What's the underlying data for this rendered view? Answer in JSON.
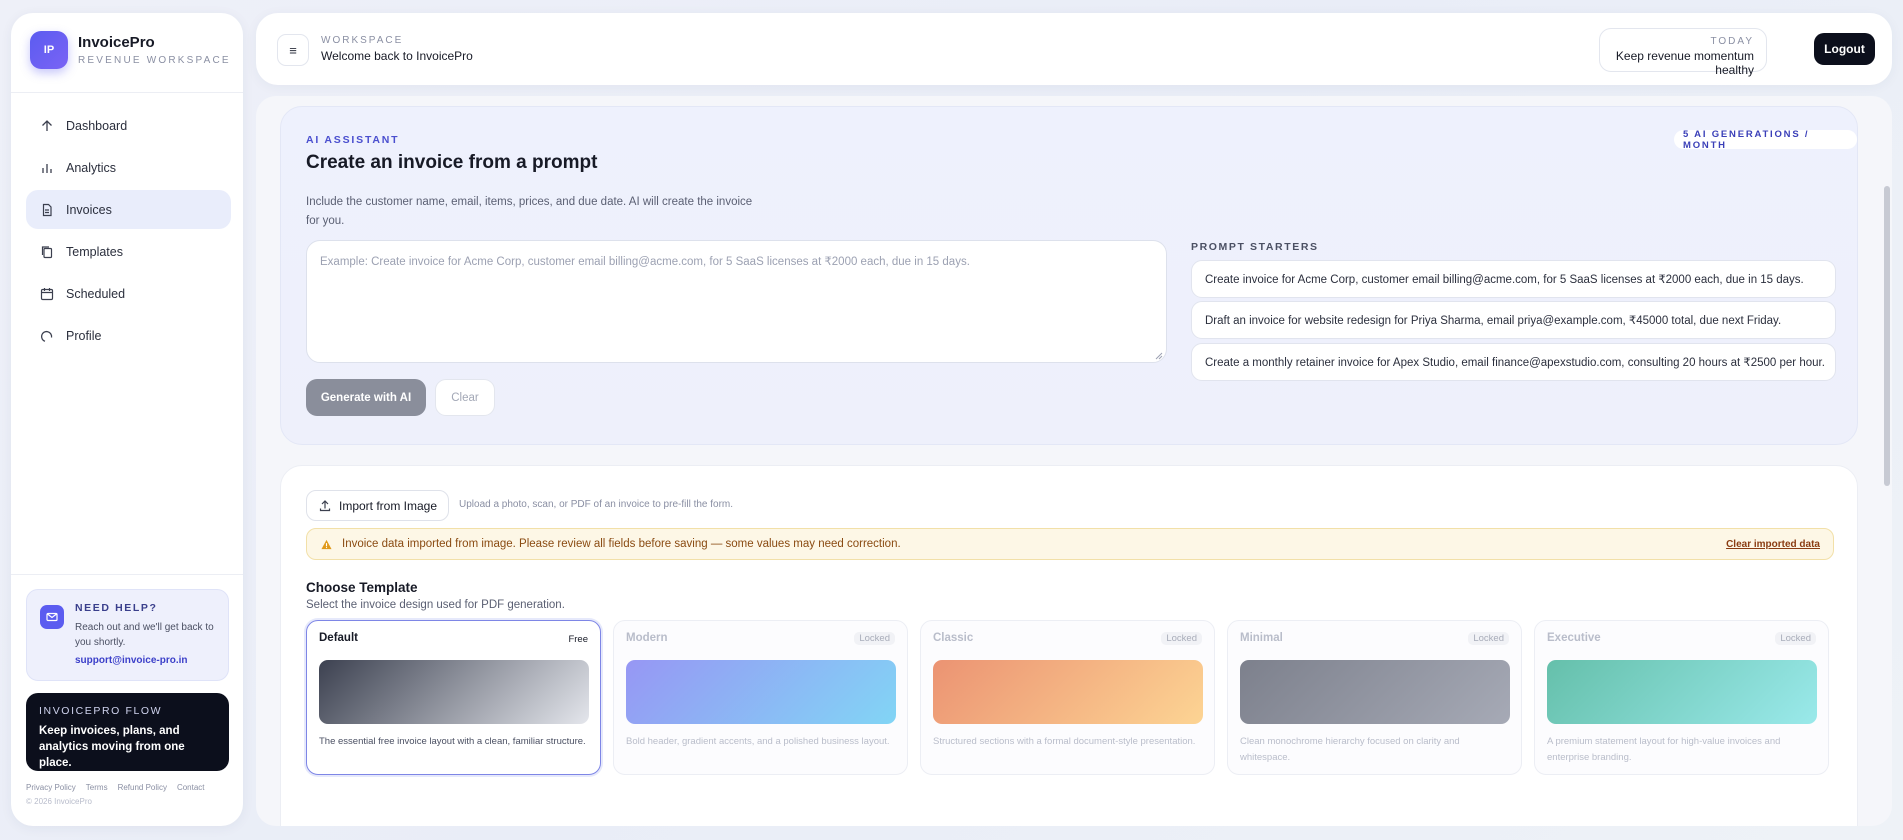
{
  "brand": {
    "logo_text": "IP",
    "name": "InvoicePro",
    "subtitle": "REVENUE WORKSPACE"
  },
  "sidebar": {
    "items": [
      {
        "label": "Dashboard",
        "icon": "arrow-up-icon"
      },
      {
        "label": "Analytics",
        "icon": "bar-chart-icon"
      },
      {
        "label": "Invoices",
        "icon": "document-icon",
        "active": true
      },
      {
        "label": "Templates",
        "icon": "copy-icon"
      },
      {
        "label": "Scheduled",
        "icon": "calendar-icon"
      },
      {
        "label": "Profile",
        "icon": "profile-icon"
      }
    ],
    "help": {
      "title": "NEED HELP?",
      "text": "Reach out and we'll get back to you shortly.",
      "email": "support@invoice-pro.in"
    },
    "flow": {
      "title": "INVOICEPRO FLOW",
      "text": "Keep invoices, plans, and analytics moving from one place."
    },
    "footer_links": [
      "Privacy Policy",
      "Terms",
      "Refund Policy",
      "Contact"
    ],
    "copyright": "© 2026 InvoicePro"
  },
  "header": {
    "menu_icon": "≡",
    "workspace_label": "WORKSPACE",
    "welcome": "Welcome back to InvoicePro",
    "today_label": "TODAY",
    "today_text": "Keep revenue momentum healthy",
    "logout": "Logout"
  },
  "ai": {
    "kicker": "AI ASSISTANT",
    "title": "Create an invoice from a prompt",
    "description": "Include the customer name, email, items, prices, and due date. AI will create the invoice for you.",
    "badge": "5 AI GENERATIONS / MONTH",
    "prompt_placeholder": "Example: Create invoice for Acme Corp, customer email billing@acme.com, for 5 SaaS licenses at ₹2000 each, due in 15 days.",
    "generate_label": "Generate with AI",
    "clear_label": "Clear",
    "starters_label": "PROMPT STARTERS",
    "starters": [
      "Create invoice for Acme Corp, customer email billing@acme.com, for 5 SaaS licenses at ₹2000 each, due in 15 days.",
      "Draft an invoice for website redesign for Priya Sharma, email priya@example.com, ₹45000 total, due next Friday.",
      "Create a monthly retainer invoice for Apex Studio, email finance@apexstudio.com, consulting 20 hours at ₹2500 per hour."
    ]
  },
  "form": {
    "import_label": "Import from Image",
    "import_hint": "Upload a photo, scan, or PDF of an invoice to pre-fill the form.",
    "warning": "Invoice data imported from image. Please review all fields before saving — some values may need correction.",
    "warning_clear": "Clear imported data",
    "choose_title": "Choose Template",
    "choose_sub": "Select the invoice design used for PDF generation.",
    "templates": [
      {
        "name": "Default",
        "badge": "Free",
        "desc": "The essential free invoice layout with a clean, familiar structure.",
        "gradient": [
          "#3c4150",
          "#e4e6ec"
        ],
        "selected": true
      },
      {
        "name": "Modern",
        "badge": "Locked",
        "desc": "Bold header, gradient accents, and a polished business layout.",
        "gradient": [
          "#6f6ff0",
          "#52c6f2"
        ]
      },
      {
        "name": "Classic",
        "badge": "Locked",
        "desc": "Structured sections with a formal document-style presentation.",
        "gradient": [
          "#e56a3c",
          "#fdc56a"
        ]
      },
      {
        "name": "Minimal",
        "badge": "Locked",
        "desc": "Clean monochrome hierarchy focused on clarity and whitespace.",
        "gradient": [
          "#4b5060",
          "#858a9a"
        ]
      },
      {
        "name": "Executive",
        "badge": "Locked",
        "desc": "A premium statement layout for high-value invoices and enterprise branding.",
        "gradient": [
          "#2aa88a",
          "#74e2e3"
        ]
      }
    ]
  }
}
